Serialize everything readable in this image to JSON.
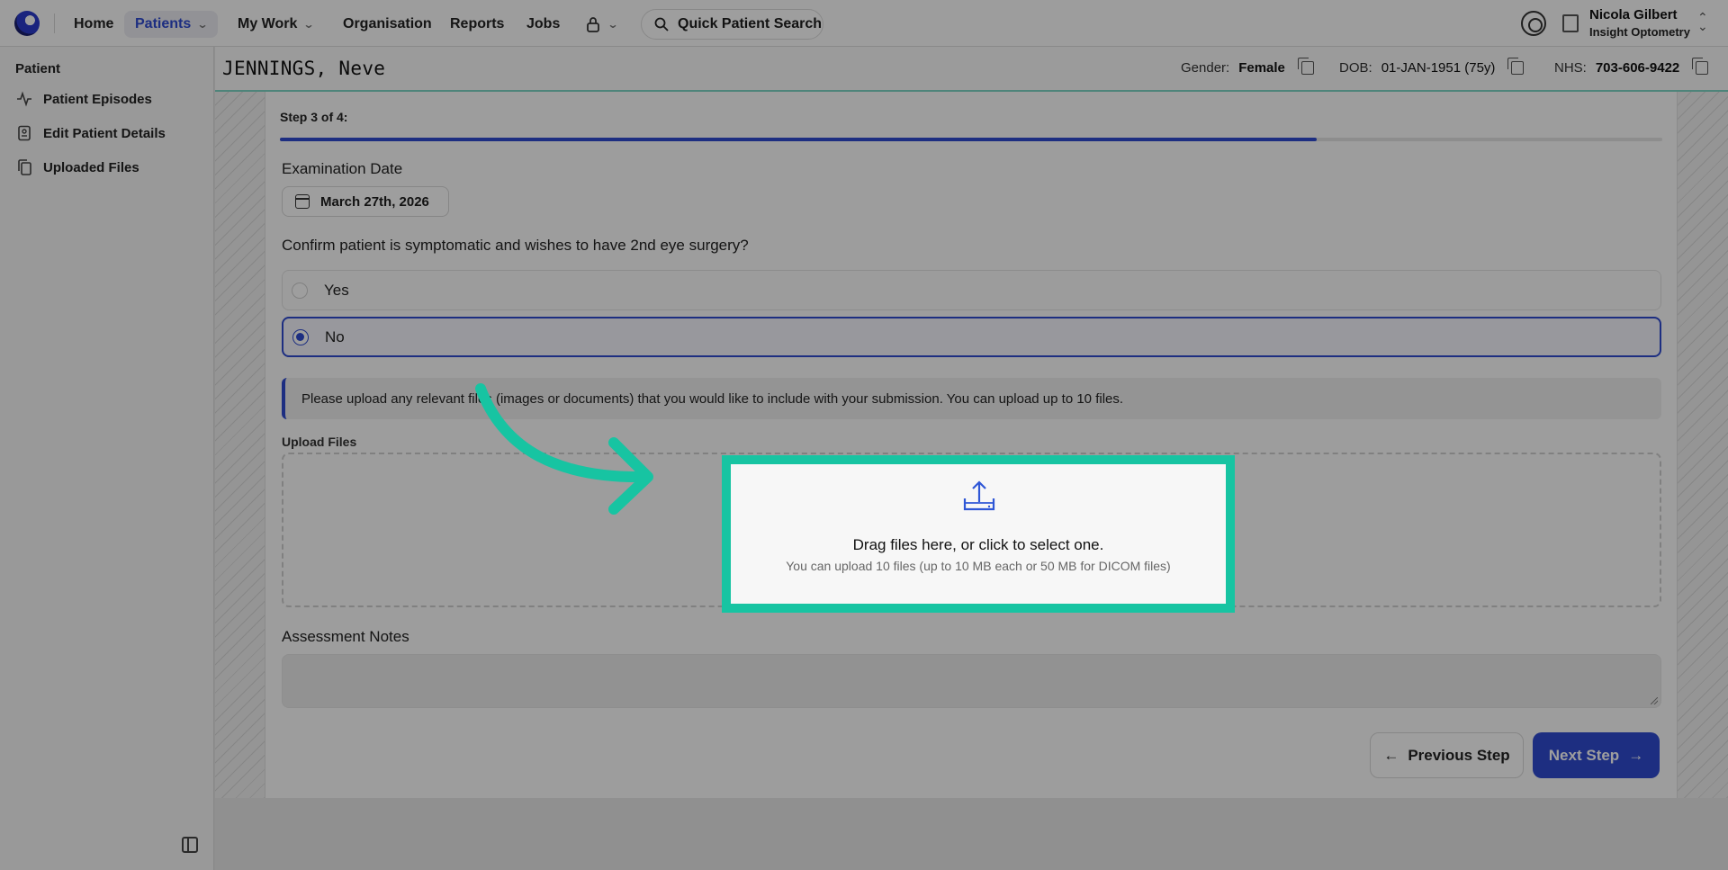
{
  "nav": {
    "home": "Home",
    "patients": "Patients",
    "my_work": "My Work",
    "organisation": "Organisation",
    "reports": "Reports",
    "jobs": "Jobs",
    "search": "Quick Patient Search"
  },
  "user": {
    "name": "Nicola Gilbert",
    "org": "Insight Optometry"
  },
  "sidebar": {
    "title": "Patient",
    "items": [
      {
        "label": "Patient Episodes",
        "icon": "activity-icon"
      },
      {
        "label": "Edit Patient Details",
        "icon": "id-card-icon"
      },
      {
        "label": "Uploaded Files",
        "icon": "files-icon"
      }
    ]
  },
  "patient": {
    "name": "JENNINGS, Neve",
    "gender_label": "Gender:",
    "gender": "Female",
    "dob_label": "DOB:",
    "dob": "01-JAN-1951 (75y)",
    "nhs_label": "NHS:",
    "nhs": "703-606-9422"
  },
  "form": {
    "step": "Step 3 of 4:",
    "progress": 0.75,
    "exam_label": "Examination Date",
    "exam_date": "March 27th, 2026",
    "question": "Confirm patient is symptomatic and wishes to have 2nd eye surgery?",
    "options": [
      {
        "label": "Yes",
        "selected": false
      },
      {
        "label": "No",
        "selected": true
      }
    ],
    "info": "Please upload any relevant files (images or documents) that you would like to include with your submission. You can upload up to 10 files.",
    "upload_label": "Upload Files",
    "upload_title": "Drag files here, or click to select one.",
    "upload_sub": "You can upload 10 files (up to 10 MB each or 50 MB for DICOM files)",
    "notes_label": "Assessment Notes",
    "prev": "Previous Step",
    "next": "Next Step"
  },
  "colors": {
    "accent": "#2f4bd1",
    "highlight": "#17c4a2"
  }
}
